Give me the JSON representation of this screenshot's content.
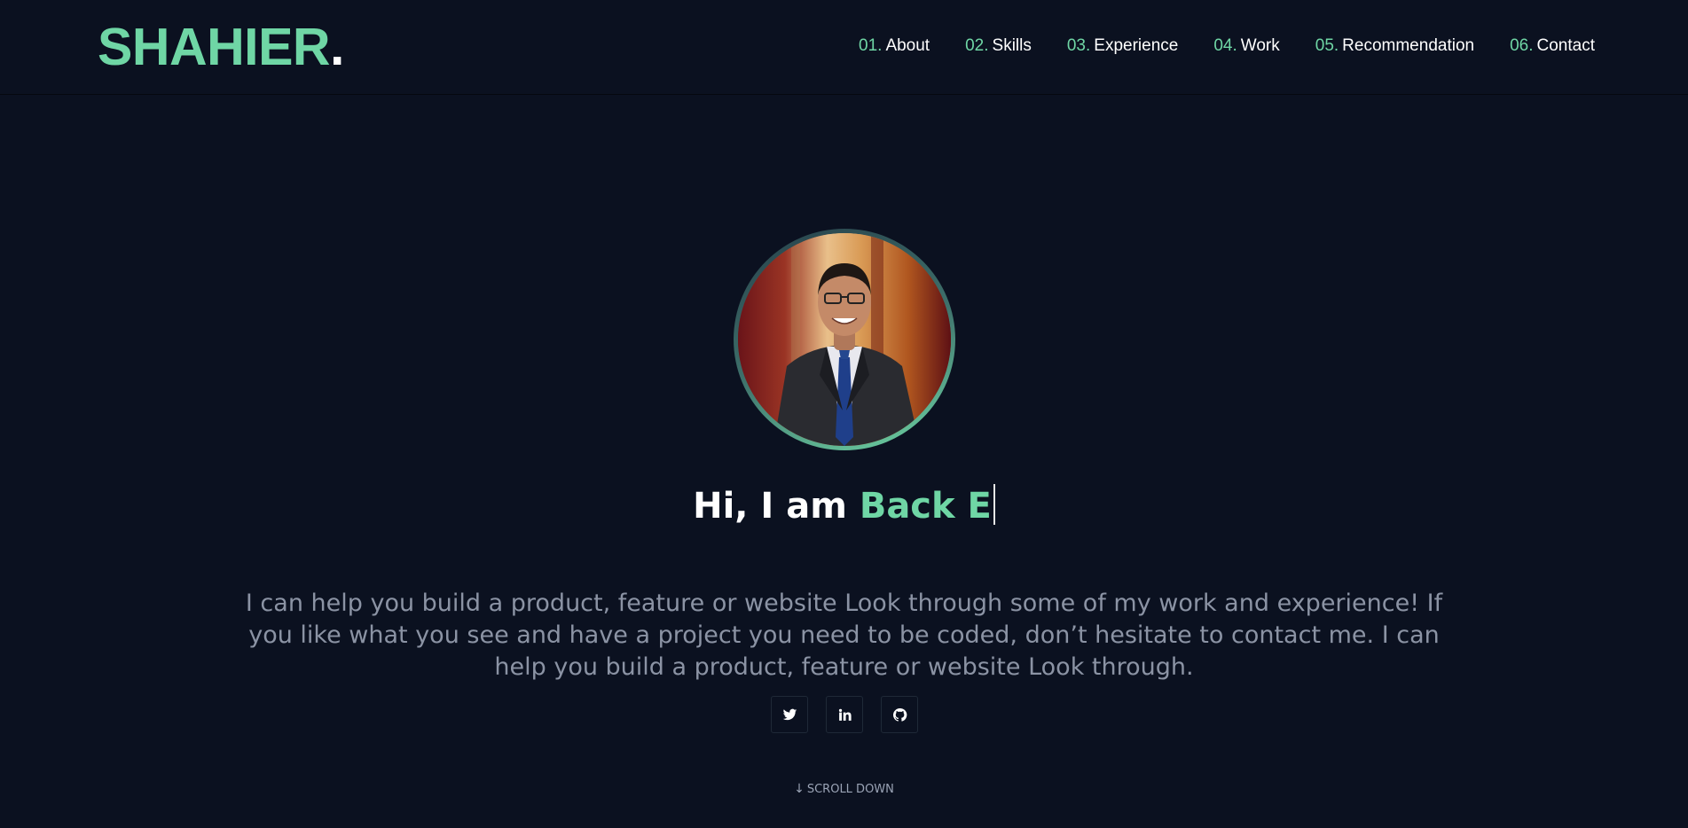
{
  "header": {
    "logo": {
      "text": "SHAHIER",
      "dot": "."
    },
    "nav": [
      {
        "num": "01.",
        "label": "About"
      },
      {
        "num": "02.",
        "label": "Skills"
      },
      {
        "num": "03.",
        "label": "Experience"
      },
      {
        "num": "04.",
        "label": "Work"
      },
      {
        "num": "05.",
        "label": "Recommendation"
      },
      {
        "num": "06.",
        "label": "Contact"
      }
    ]
  },
  "hero": {
    "greeting": "Hi, I am ",
    "typed_role": "Back E",
    "intro": "I can help you build a product, feature or website Look through some of my work and experience! If you like what you see and have a project you need to be coded, don’t hesitate to contact me. I can help you build a product, feature or website Look through.",
    "socials": [
      {
        "icon": "twitter-icon"
      },
      {
        "icon": "linkedin-icon"
      },
      {
        "icon": "github-icon"
      }
    ],
    "scroll": {
      "arrow": "↓",
      "label": "SCROLL DOWN"
    }
  },
  "colors": {
    "background": "#0b1120",
    "accent": "#6fd6a5",
    "muted_text": "#8b93a4"
  }
}
